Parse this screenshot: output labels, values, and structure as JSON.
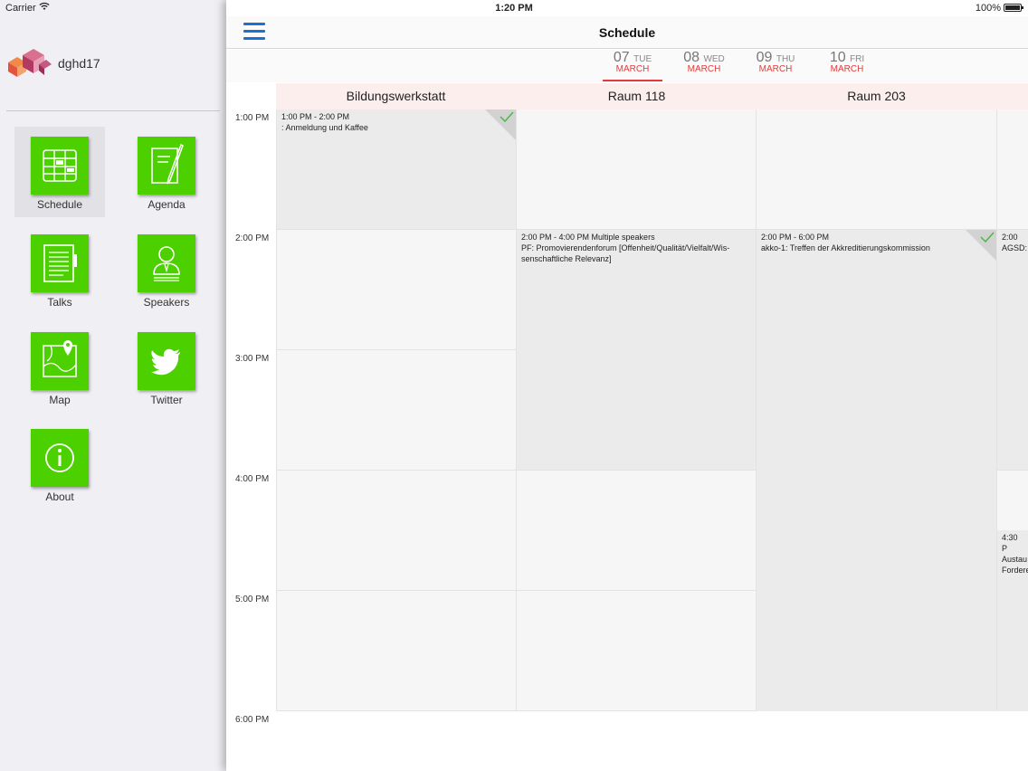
{
  "status": {
    "carrier": "Carrier",
    "time": "1:20 PM",
    "battery": "100%"
  },
  "menu": {
    "app_name": "dghd17",
    "items": [
      {
        "label": "Schedule",
        "icon": "schedule-icon"
      },
      {
        "label": "Agenda",
        "icon": "agenda-icon"
      },
      {
        "label": "Talks",
        "icon": "talks-icon"
      },
      {
        "label": "Speakers",
        "icon": "speakers-icon"
      },
      {
        "label": "Map",
        "icon": "map-icon"
      },
      {
        "label": "Twitter",
        "icon": "twitter-icon"
      },
      {
        "label": "About",
        "icon": "info-icon"
      }
    ],
    "accent_color": "#4cd000"
  },
  "navbar": {
    "title": "Schedule"
  },
  "days": [
    {
      "num": "07",
      "dow": "TUE",
      "month": "MARCH"
    },
    {
      "num": "08",
      "dow": "WED",
      "month": "MARCH"
    },
    {
      "num": "09",
      "dow": "THU",
      "month": "MARCH"
    },
    {
      "num": "10",
      "dow": "FRI",
      "month": "MARCH"
    }
  ],
  "rooms": [
    "Bildungswerkstatt",
    "Raum 118",
    "Raum 203"
  ],
  "times": [
    "1:00 PM",
    "2:00 PM",
    "3:00 PM",
    "4:00 PM",
    "5:00 PM",
    "6:00 PM"
  ],
  "events": [
    {
      "time": "1:00 PM - 2:00 PM",
      "title": ": Anmeldung und Kaffee"
    },
    {
      "time": "2:00 PM - 4:00 PM  Multiple speakers",
      "title": "PF: Promovierendenforum [Offenheit/Qualität/Vielfalt/Wis-senschaftliche Relevanz]"
    },
    {
      "time": "2:00 PM - 6:00 PM",
      "title": "akko-1: Treffen der Akkreditierungskommission"
    },
    {
      "time": "2:00",
      "title": "AGSD:"
    },
    {
      "time": "4:30 P",
      "title": "Austau",
      "title2": "Fordere"
    }
  ]
}
